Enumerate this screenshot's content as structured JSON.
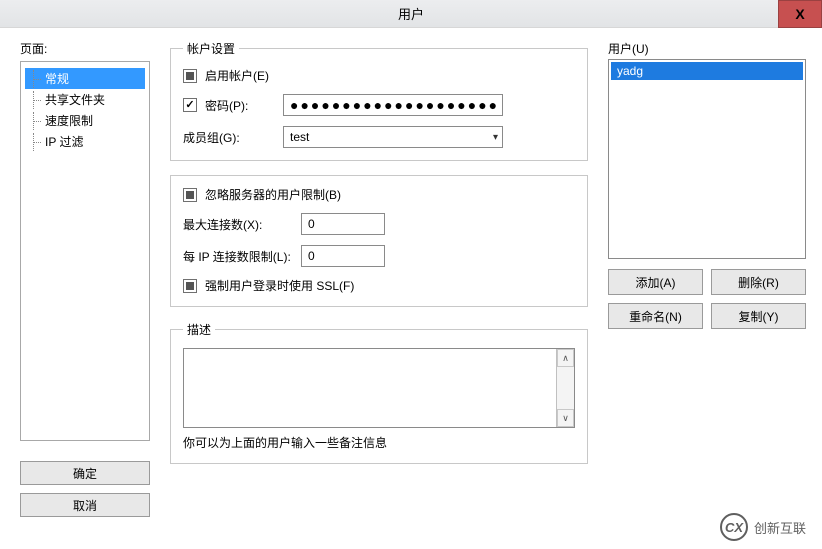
{
  "window": {
    "title": "用户",
    "close_glyph": "X"
  },
  "left": {
    "pages_label": "页面:",
    "items": [
      "常规",
      "共享文件夹",
      "速度限制",
      "IP 过滤"
    ],
    "selected_index": 0,
    "ok_label": "确定",
    "cancel_label": "取消"
  },
  "account": {
    "legend": "帐户设置",
    "enable_account_label": "启用帐户(E)",
    "enable_account_checked": false,
    "password_label": "密码(P):",
    "password_checked": true,
    "password_value": "●●●●●●●●●●●●●●●●●●●●●●",
    "group_label": "成员组(G):",
    "group_value": "test"
  },
  "limits": {
    "bypass_label": "忽略服务器的用户限制(B)",
    "bypass_state": "indeterminate",
    "max_conn_label": "最大连接数(X):",
    "max_conn_value": "0",
    "per_ip_label": "每 IP 连接数限制(L):",
    "per_ip_value": "0",
    "force_ssl_label": "强制用户登录时使用 SSL(F)",
    "force_ssl_state": "indeterminate"
  },
  "description": {
    "legend": "描述",
    "value": "",
    "hint": "你可以为上面的用户输入一些备注信息"
  },
  "users": {
    "label": "用户(U)",
    "items": [
      "yadg"
    ],
    "selected_index": 0,
    "add_label": "添加(A)",
    "delete_label": "删除(R)",
    "rename_label": "重命名(N)",
    "copy_label": "复制(Y)"
  },
  "watermark": {
    "icon": "CX",
    "text": "创新互联"
  }
}
